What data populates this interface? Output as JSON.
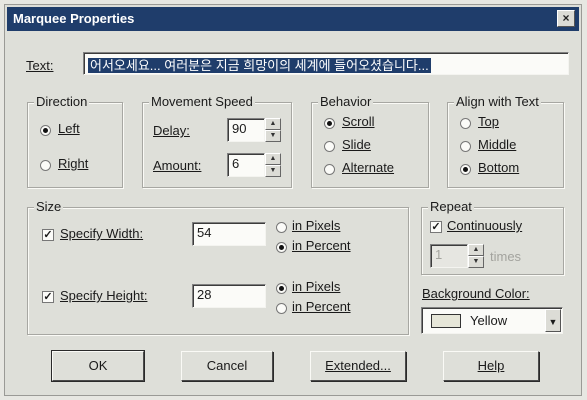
{
  "window": {
    "title": "Marquee Properties",
    "close_glyph": "×"
  },
  "text_field": {
    "label": "Text:",
    "label_underline": "T",
    "value": "어서오세요... 여러분은 지금 희망이의 세계에 들어오셨습니다..."
  },
  "direction": {
    "legend": "Direction",
    "options": [
      {
        "label": "Left",
        "underline": "L",
        "selected": true
      },
      {
        "label": "Right",
        "underline": "R",
        "selected": false
      }
    ]
  },
  "movement_speed": {
    "legend": "Movement Speed",
    "delay": {
      "label": "Delay:",
      "value": "90"
    },
    "amount": {
      "label": "Amount:",
      "value": "6"
    }
  },
  "behavior": {
    "legend": "Behavior",
    "options": [
      {
        "label": "Scroll",
        "selected": true
      },
      {
        "label": "Slide",
        "selected": false
      },
      {
        "label": "Alternate",
        "selected": false
      }
    ]
  },
  "align": {
    "legend": "Align with Text",
    "options": [
      {
        "label": "Top",
        "selected": false
      },
      {
        "label": "Middle",
        "selected": false
      },
      {
        "label": "Bottom",
        "selected": true
      }
    ]
  },
  "size": {
    "legend": "Size",
    "width": {
      "label": "Specify Width:",
      "checked": true,
      "value": "54",
      "unit_pixels": "in Pixels",
      "unit_percent": "in Percent",
      "unit": "percent"
    },
    "height": {
      "label": "Specify Height:",
      "checked": true,
      "value": "28",
      "unit_pixels": "in Pixels",
      "unit_percent": "in Percent",
      "unit": "pixels"
    }
  },
  "repeat": {
    "legend": "Repeat",
    "continuously": {
      "label": "Continuously",
      "checked": true
    },
    "count_value": "1",
    "times_label": "times"
  },
  "background": {
    "label": "Background Color:",
    "value": "Yellow",
    "swatch_color": "#e6e6d8"
  },
  "buttons": {
    "ok": "OK",
    "cancel": "Cancel",
    "extended": "Extended...",
    "help": "Help"
  },
  "colors": {
    "titlebar": "#1f3d6b",
    "face": "#dedfd9"
  }
}
